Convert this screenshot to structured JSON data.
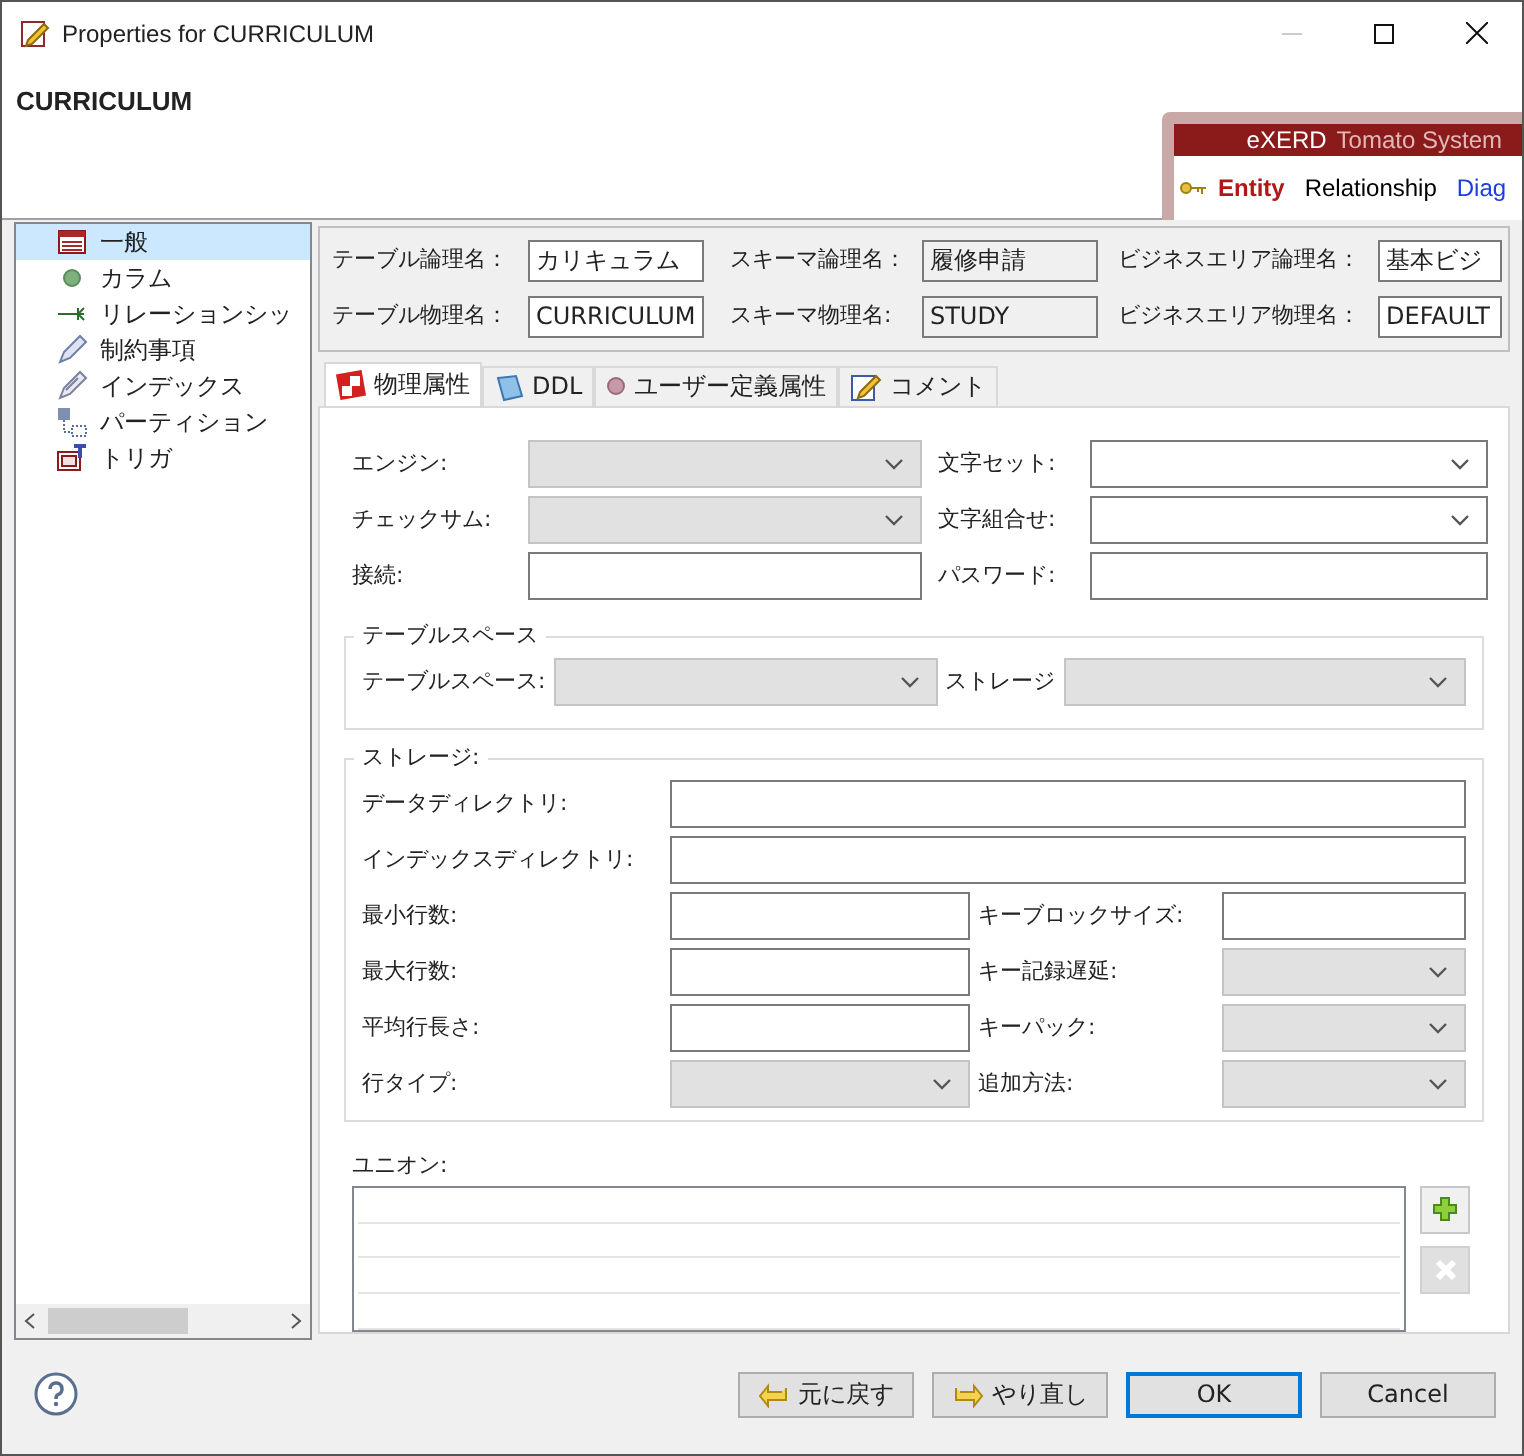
{
  "window": {
    "title": "Properties for CURRICULUM"
  },
  "header": {
    "title": "CURRICULUM"
  },
  "banner": {
    "brand": "eXERD",
    "subtitle": "Tomato System",
    "tabs": [
      {
        "label": "Entity",
        "selected": true
      },
      {
        "label": "Relationship",
        "selected": false
      },
      {
        "label": "Diag",
        "selected": false
      }
    ]
  },
  "tree": {
    "items": [
      {
        "label": "一般",
        "selected": true
      },
      {
        "label": "カラム",
        "selected": false
      },
      {
        "label": "リレーションシッ",
        "selected": false
      },
      {
        "label": "制約事項",
        "selected": false
      },
      {
        "label": "インデックス",
        "selected": false
      },
      {
        "label": "パーティション",
        "selected": false
      },
      {
        "label": "トリガ",
        "selected": false
      }
    ]
  },
  "names": [
    [
      {
        "label": "テーブル論理名：",
        "value": "カリキュラム",
        "disabled": false
      },
      {
        "label": "スキーマ論理名：",
        "value": "履修申請",
        "disabled": true
      },
      {
        "label": "ビジネスエリア論理名：",
        "value": "基本ビジ",
        "disabled": false
      }
    ],
    [
      {
        "label": "テーブル物理名：",
        "value": "CURRICULUM",
        "disabled": false
      },
      {
        "label": "スキーマ物理名:",
        "value": "STUDY",
        "disabled": true
      },
      {
        "label": "ビジネスエリア物理名：",
        "value": "DEFAULT",
        "disabled": false
      }
    ]
  ],
  "tabs": [
    {
      "label": "物理属性",
      "selected": true
    },
    {
      "label": "DDL",
      "selected": false
    },
    {
      "label": "ユーザー定義属性",
      "selected": false
    },
    {
      "label": "コメント",
      "selected": false
    }
  ],
  "physical": [
    [
      {
        "label": "エンジン:",
        "kind": "combo",
        "disabled": true
      },
      {
        "label": "文字セット:",
        "kind": "combo",
        "disabled": false
      }
    ],
    [
      {
        "label": "チェックサム:",
        "kind": "combo",
        "disabled": true
      },
      {
        "label": "文字組合せ:",
        "kind": "combo",
        "disabled": false
      }
    ],
    [
      {
        "label": "接続:",
        "kind": "text",
        "disabled": false
      },
      {
        "label": "パスワード:",
        "kind": "text",
        "disabled": false
      }
    ]
  ],
  "tablespace": {
    "title": "テーブルスペース",
    "fields": [
      {
        "label": "テーブルスペース:",
        "kind": "combo",
        "disabled": true
      },
      {
        "label": "ストレージ",
        "kind": "combo",
        "disabled": true
      }
    ]
  },
  "storage": {
    "title": "ストレージ:",
    "rows": [
      [
        {
          "label": "データディレクトリ:",
          "kind": "text",
          "disabled": false
        }
      ],
      [
        {
          "label": "インデックスディレクトリ:",
          "kind": "text",
          "disabled": false
        }
      ],
      [
        {
          "label": "最小行数:",
          "kind": "text",
          "disabled": false
        },
        {
          "label": "キーブロックサイズ:",
          "kind": "text",
          "disabled": false
        }
      ],
      [
        {
          "label": "最大行数:",
          "kind": "text",
          "disabled": false
        },
        {
          "label": "キー記録遅延:",
          "kind": "combo",
          "disabled": true
        }
      ],
      [
        {
          "label": "平均行長さ:",
          "kind": "text",
          "disabled": false
        },
        {
          "label": "キーパック:",
          "kind": "combo",
          "disabled": true
        }
      ],
      [
        {
          "label": "行タイプ:",
          "kind": "combo",
          "disabled": true
        },
        {
          "label": "追加方法:",
          "kind": "combo",
          "disabled": true
        }
      ]
    ]
  },
  "union": {
    "label": "ユニオン:",
    "add_disabled": false,
    "remove_disabled": true
  },
  "footer": {
    "buttons": [
      {
        "label": "元に戻す",
        "kind": "undo",
        "default": false
      },
      {
        "label": "やり直し",
        "kind": "redo",
        "default": false
      },
      {
        "label": "OK",
        "kind": "plain",
        "default": true
      },
      {
        "label": "Cancel",
        "kind": "plain",
        "default": false
      }
    ]
  }
}
